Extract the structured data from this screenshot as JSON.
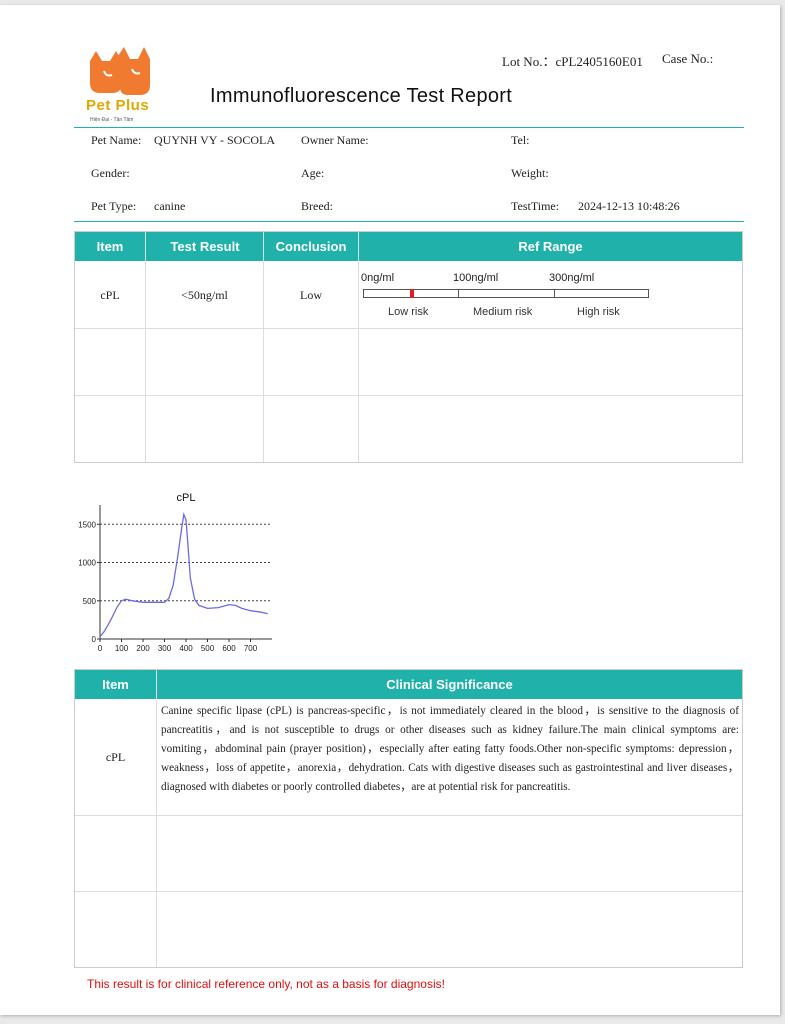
{
  "header": {
    "lot_label": "Lot No.：",
    "lot_value": "cPL2405160E01",
    "case_label": "Case No.:",
    "title": "Immunofluorescence Test Report"
  },
  "logo": {
    "brand": "Pet Plus",
    "tagline": "Hiện Đại - Tận Tâm",
    "brand_color": "#f07a30",
    "text_color": "#e0a800"
  },
  "patient": {
    "pet_name_label": "Pet Name:",
    "pet_name_value": "QUYNH VY - SOCOLA",
    "owner_label": "Owner Name:",
    "tel_label": "Tel:",
    "gender_label": "Gender:",
    "age_label": "Age:",
    "weight_label": "Weight:",
    "pet_type_label": "Pet Type:",
    "pet_type_value": "canine",
    "breed_label": "Breed:",
    "testtime_label": "TestTime:",
    "testtime_value": "2024-12-13 10:48:26"
  },
  "results_table": {
    "headers": [
      "Item",
      "Test Result",
      "Conclusion",
      "Ref Range"
    ],
    "rows": [
      {
        "item": "cPL",
        "result": "<50ng/ml",
        "conclusion": "Low"
      }
    ],
    "range": {
      "ticks": [
        "0ng/ml",
        "100ng/ml",
        "300ng/ml"
      ],
      "zones": [
        "Low risk",
        "Medium risk",
        "High risk"
      ],
      "marker_value": 50,
      "marker_color": "#e02020"
    }
  },
  "chart_data": {
    "type": "line",
    "title": "cPL",
    "xlabel": "",
    "ylabel": "",
    "xlim": [
      0,
      800
    ],
    "ylim": [
      0,
      1700
    ],
    "x_ticks": [
      "0",
      "100",
      "200",
      "300",
      "400",
      "500",
      "600",
      "700"
    ],
    "y_ticks": [
      "0",
      "500",
      "1000",
      "1500"
    ],
    "grid": "horizontal dashed at 500, 1000, 1500",
    "series": [
      {
        "color": "#6b6bea",
        "x": [
          0,
          20,
          50,
          80,
          100,
          120,
          150,
          200,
          250,
          300,
          320,
          340,
          360,
          380,
          390,
          400,
          410,
          420,
          440,
          460,
          500,
          550,
          600,
          630,
          660,
          700,
          750,
          780
        ],
        "y": [
          30,
          100,
          250,
          420,
          500,
          520,
          500,
          480,
          480,
          480,
          530,
          700,
          1050,
          1450,
          1630,
          1560,
          1200,
          800,
          520,
          440,
          400,
          410,
          450,
          440,
          400,
          370,
          350,
          330
        ]
      }
    ]
  },
  "clinical_table": {
    "headers": [
      "Item",
      "Clinical Significance"
    ],
    "rows": [
      {
        "item": "cPL",
        "text": "Canine specific lipase (cPL) is pancreas-specific，is not immediately cleared in the blood，is sensitive to the diagnosis of pancreatitis，and is not susceptible to drugs or other diseases such as kidney failure.The main clinical symptoms are: vomiting，abdominal pain (prayer position)，especially after eating fatty foods.Other non-specific symptoms: depression，weakness，loss of appetite，anorexia，dehydration. Cats with digestive diseases such as gastrointestinal and liver diseases，diagnosed with diabetes or poorly controlled diabetes，are at potential risk for pancreatitis."
      }
    ]
  },
  "footer": {
    "disclaimer": "This result is for clinical reference only, not as a basis for diagnosis!",
    "disclaimer_color": "#e01010"
  }
}
